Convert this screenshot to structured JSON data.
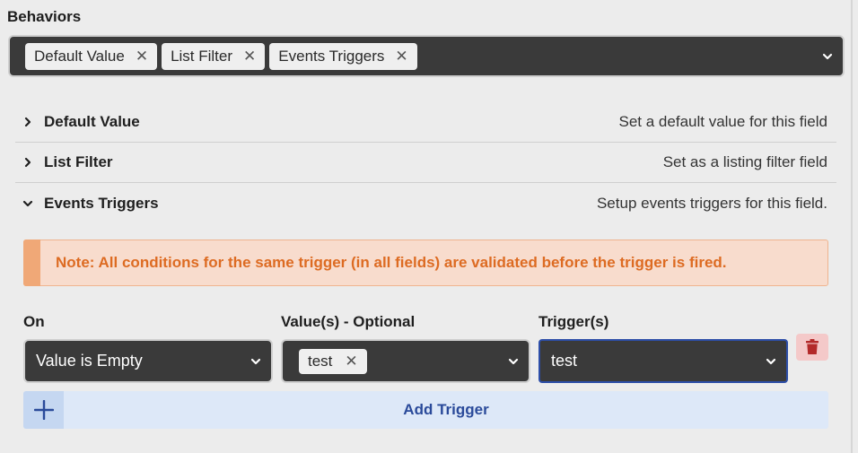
{
  "behaviors": {
    "title": "Behaviors",
    "selected": [
      "Default Value",
      "List Filter",
      "Events Triggers"
    ],
    "remove_glyph": "✕"
  },
  "sections": [
    {
      "title": "Default Value",
      "description": "Set a default value for this field",
      "expanded": false
    },
    {
      "title": "List Filter",
      "description": "Set as a listing filter field",
      "expanded": false
    },
    {
      "title": "Events Triggers",
      "description": "Setup events triggers for this field.",
      "expanded": true
    }
  ],
  "note": {
    "text": "Note: All conditions for the same trigger (in all fields) are validated before the trigger is fired."
  },
  "trigger_row": {
    "on_label": "On",
    "values_label": "Value(s) - Optional",
    "triggers_label": "Trigger(s)",
    "on_value": "Value is Empty",
    "values_chip": "test",
    "triggers_value": "test"
  },
  "add_trigger": {
    "label": "Add Trigger"
  },
  "colors": {
    "accent": "#2a4a9a",
    "note_text": "#dd6b22",
    "delete_icon": "#b32a2a",
    "select_bg": "#3a3a3a"
  }
}
